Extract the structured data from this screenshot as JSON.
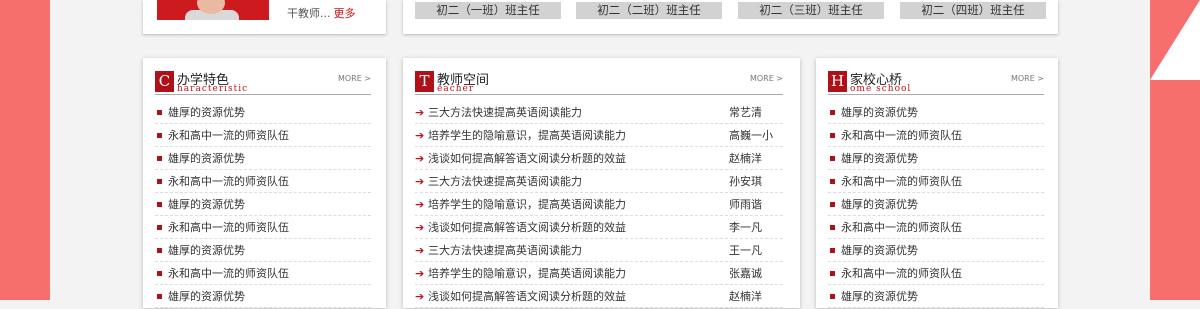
{
  "colors": {
    "accent": "#b01017",
    "side": "#f66f6c",
    "link_more": "#c0141a"
  },
  "teacher": {
    "text": "干教师...",
    "more": "更多"
  },
  "classes": [
    "初二（一班）班主任",
    "初二（二班）班主任",
    "初二（三班）班主任",
    "初二（四班）班主任"
  ],
  "panels": [
    {
      "badge": "C",
      "title": "办学特色",
      "subtitle": "haracteristic",
      "more": "MORE >",
      "items": [
        "雄厚的资源优势",
        "永和高中一流的师资队伍",
        "雄厚的资源优势",
        "永和高中一流的师资队伍",
        "雄厚的资源优势",
        "永和高中一流的师资队伍",
        "雄厚的资源优势",
        "永和高中一流的师资队伍",
        "雄厚的资源优势"
      ]
    },
    {
      "badge": "T",
      "title": "教师空间",
      "subtitle": "eacher",
      "more": "MORE >",
      "items": [
        {
          "title": "三大方法快速提高英语阅读能力",
          "author": "常艺清"
        },
        {
          "title": "培养学生的隐喻意识，提高英语阅读能力",
          "author": "高巍一小"
        },
        {
          "title": "浅谈如何提高解答语文阅读分析题的效益",
          "author": "赵楠洋"
        },
        {
          "title": "三大方法快速提高英语阅读能力",
          "author": "孙安琪"
        },
        {
          "title": "培养学生的隐喻意识，提高英语阅读能力",
          "author": "师雨谐"
        },
        {
          "title": "浅谈如何提高解答语文阅读分析题的效益",
          "author": "李一凡"
        },
        {
          "title": "三大方法快速提高英语阅读能力",
          "author": "王一凡"
        },
        {
          "title": "培养学生的隐喻意识，提高英语阅读能力",
          "author": "张嘉诚"
        },
        {
          "title": "浅谈如何提高解答语文阅读分析题的效益",
          "author": "赵楠洋"
        }
      ]
    },
    {
      "badge": "H",
      "title": "家校心桥",
      "subtitle": "ome school",
      "more": "MORE >",
      "items": [
        "雄厚的资源优势",
        "永和高中一流的师资队伍",
        "雄厚的资源优势",
        "永和高中一流的师资队伍",
        "雄厚的资源优势",
        "永和高中一流的师资队伍",
        "雄厚的资源优势",
        "永和高中一流的师资队伍",
        "雄厚的资源优势"
      ]
    }
  ]
}
